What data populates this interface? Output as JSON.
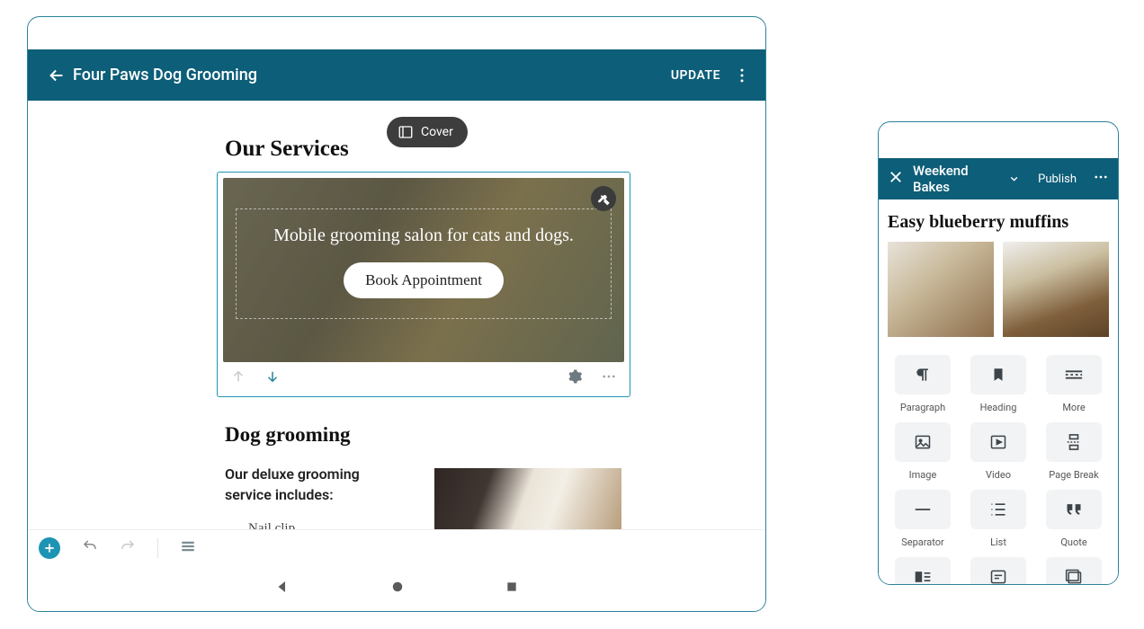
{
  "tablet": {
    "header": {
      "title": "Four Paws Dog Grooming",
      "update": "UPDATE"
    },
    "cover_chip": "Cover",
    "section_heading": "Our Services",
    "cover_text": "Mobile grooming salon for cats and dogs.",
    "cover_button": "Book Appointment",
    "sub_heading": "Dog grooming",
    "body_text_1": "Our deluxe grooming",
    "body_text_2": "service includes:",
    "list_item_1": "Nail clip"
  },
  "phone": {
    "header": {
      "brand": "Weekend Bakes",
      "publish": "Publish"
    },
    "article_title": "Easy blueberry muffins",
    "blocks": [
      {
        "label": "Paragraph"
      },
      {
        "label": "Heading"
      },
      {
        "label": "More"
      },
      {
        "label": "Image"
      },
      {
        "label": "Video"
      },
      {
        "label": "Page Break"
      },
      {
        "label": "Separator"
      },
      {
        "label": "List"
      },
      {
        "label": "Quote"
      }
    ]
  }
}
